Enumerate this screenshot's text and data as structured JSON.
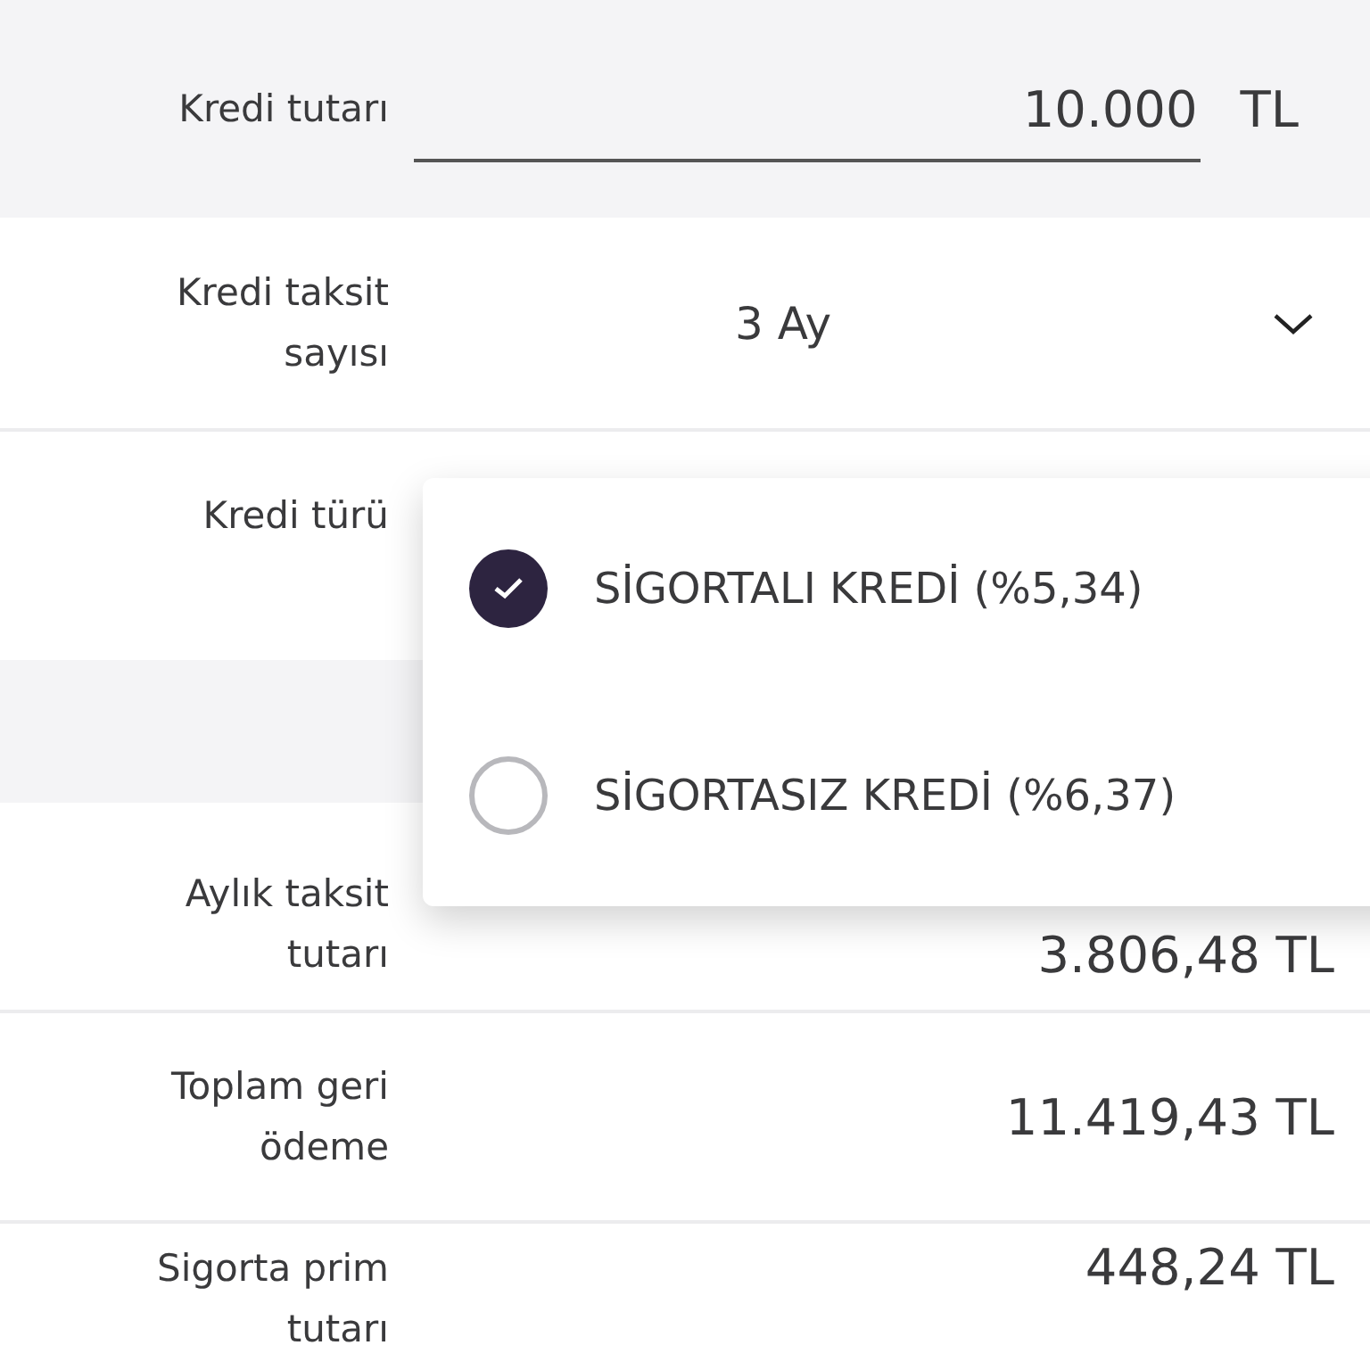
{
  "amount": {
    "label": "Kredi tutarı",
    "value": "10.000",
    "currency": "TL"
  },
  "installments": {
    "label": "Kredi taksit sayısı",
    "value": "3 Ay"
  },
  "loan_type": {
    "label": "Kredi türü",
    "options": [
      {
        "label": "SİGORTALI KREDİ (%5,34)",
        "selected": true
      },
      {
        "label": "SİGORTASIZ KREDİ (%6,37)",
        "selected": false
      }
    ]
  },
  "results": [
    {
      "label": "Aylık taksit tutarı",
      "value": "3.806,48 TL"
    },
    {
      "label": "Toplam geri ödeme",
      "value": "11.419,43 TL"
    },
    {
      "label": "Sigorta prim tutarı",
      "value": "448,24 TL"
    }
  ]
}
